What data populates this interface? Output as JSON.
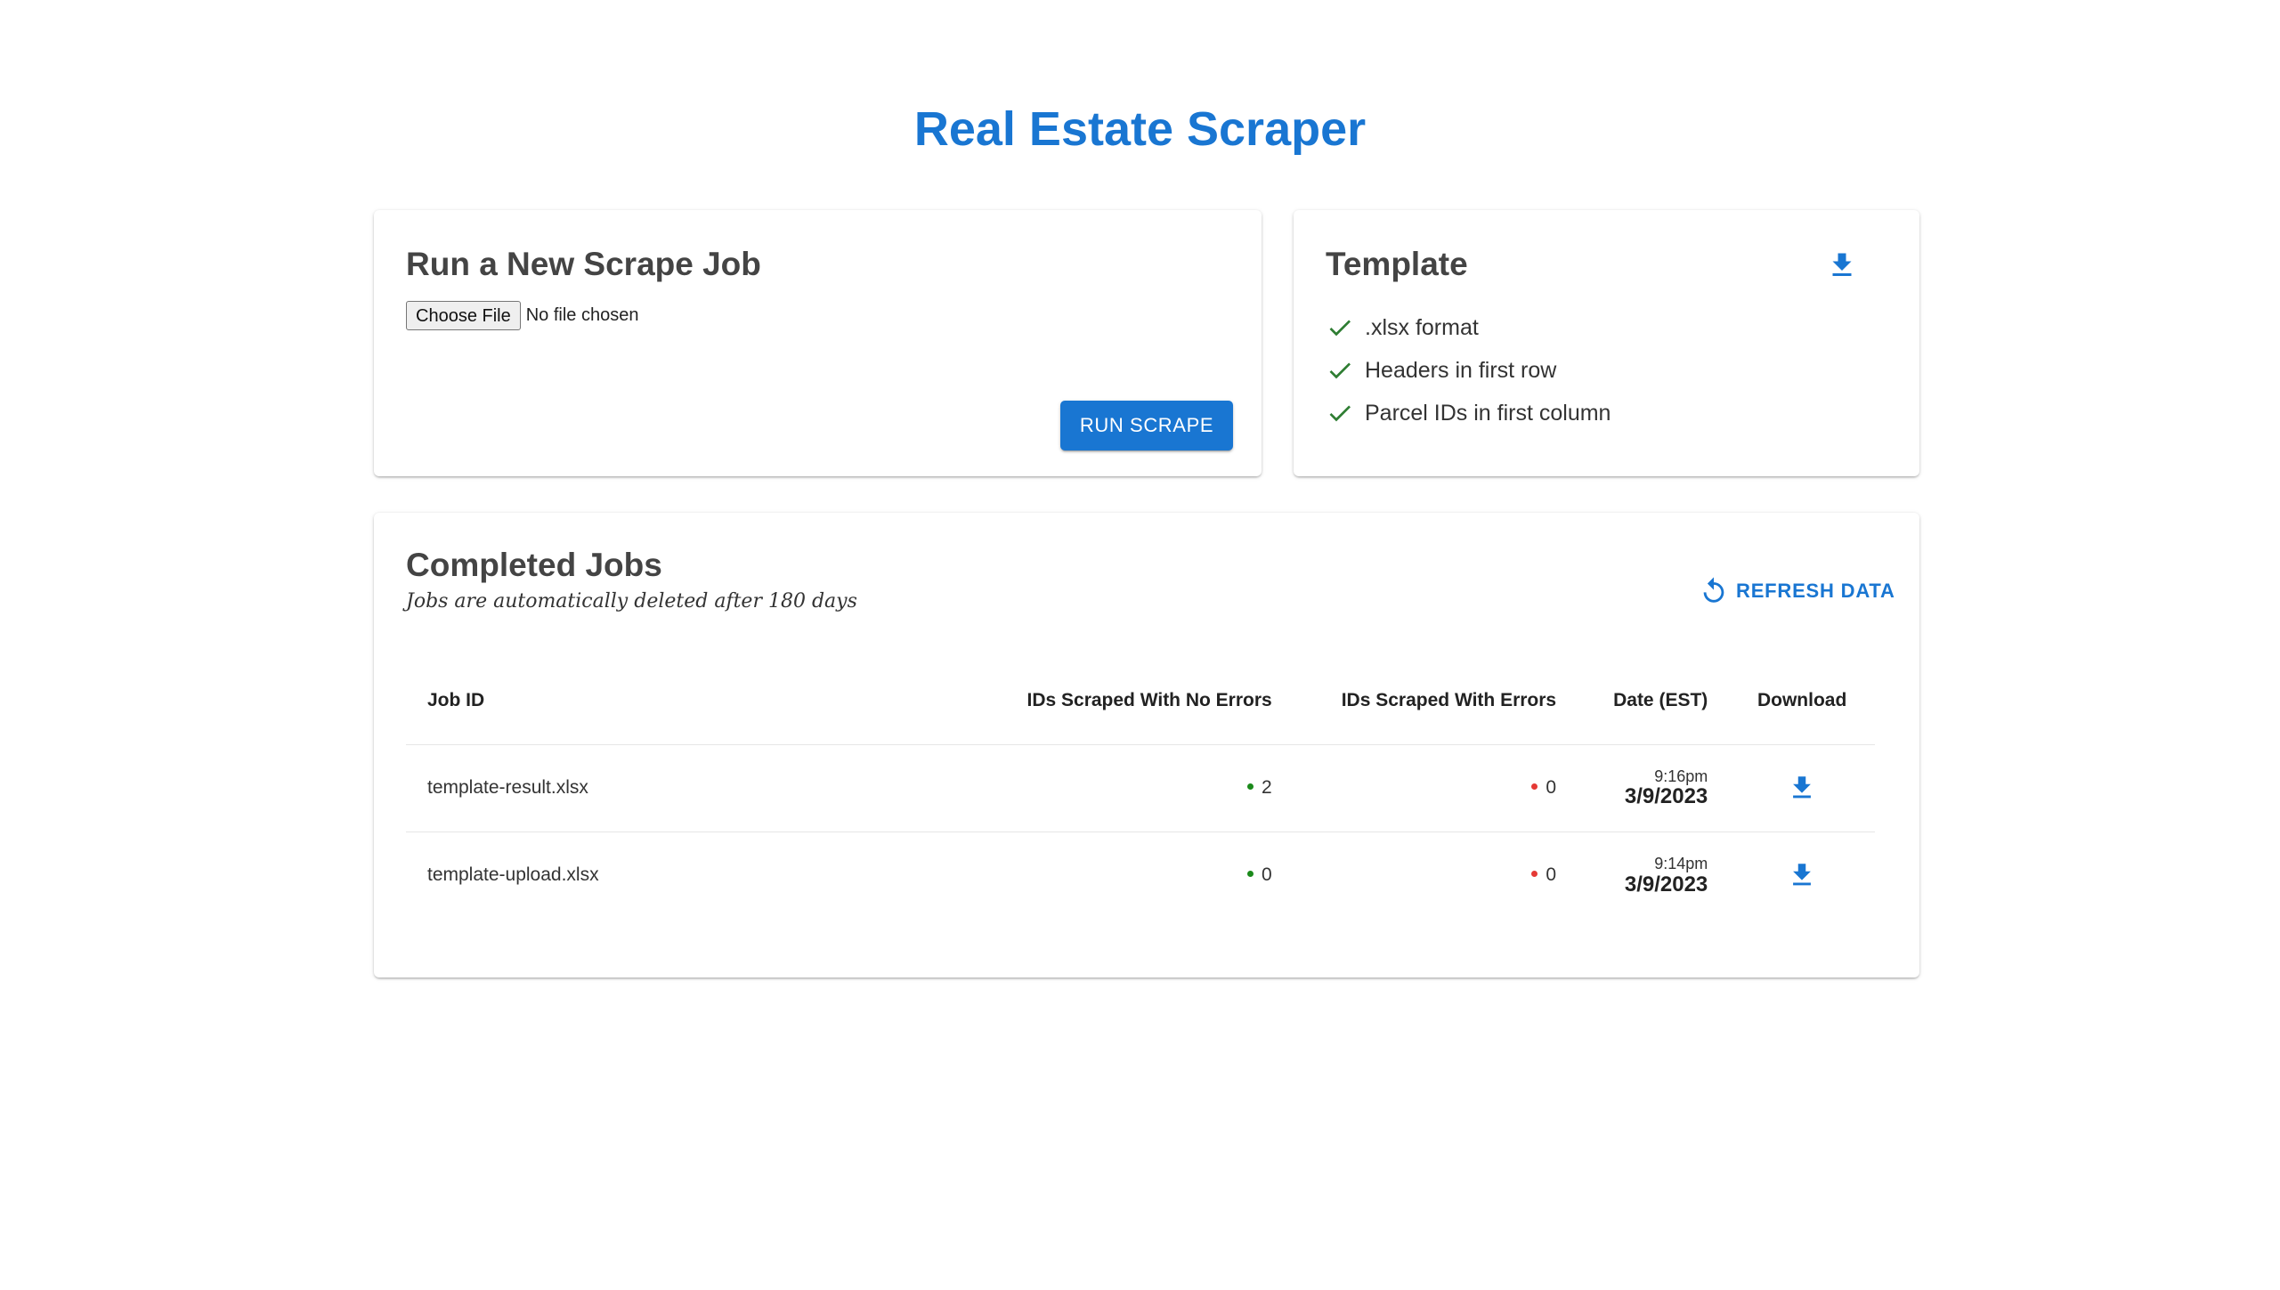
{
  "app": {
    "title": "Real Estate Scraper"
  },
  "scrape_card": {
    "title": "Run a New Scrape Job",
    "file_button_label": "Choose File",
    "file_status": "No file chosen",
    "run_button_label": "RUN SCRAPE"
  },
  "template_card": {
    "title": "Template",
    "download_icon": "download-icon",
    "requirements": [
      ".xlsx format",
      "Headers in first row",
      "Parcel IDs in first column"
    ]
  },
  "jobs_card": {
    "title": "Completed Jobs",
    "subtitle": "Jobs are automatically deleted after 180 days",
    "refresh_label": "REFRESH DATA",
    "columns": {
      "job_id": "Job ID",
      "no_errors": "IDs Scraped With No Errors",
      "with_errors": "IDs Scraped With Errors",
      "date": "Date (EST)",
      "download": "Download"
    },
    "rows": [
      {
        "job_id": "template-result.xlsx",
        "no_errors": "2",
        "with_errors": "0",
        "time": "9:16pm",
        "date": "3/9/2023"
      },
      {
        "job_id": "template-upload.xlsx",
        "no_errors": "0",
        "with_errors": "0",
        "time": "9:14pm",
        "date": "3/9/2023"
      }
    ]
  },
  "colors": {
    "primary": "#1976d2",
    "success": "#2e7d32",
    "success_dot": "#1b8a1b",
    "error_dot": "#e53935",
    "text": "#444444"
  }
}
